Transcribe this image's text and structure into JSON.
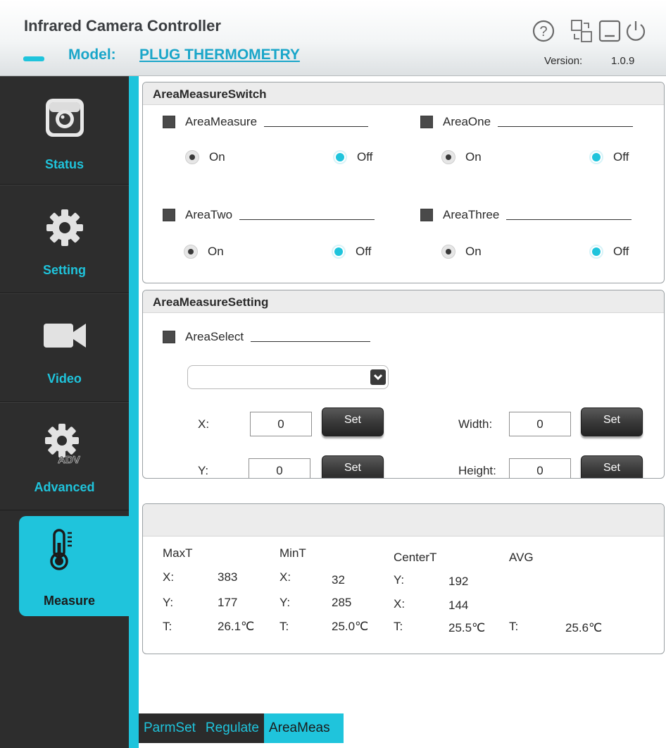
{
  "header": {
    "title": "Infrared Camera Controller",
    "model_label": "Model:",
    "model_value": "PLUG THERMOMETRY",
    "version_label": "Version:",
    "version_value": "1.0.9",
    "icons": [
      "help-icon",
      "switch-icon",
      "minimize-icon",
      "power-icon"
    ]
  },
  "sidebar": {
    "items": [
      {
        "label": "Status",
        "icon": "camera-icon"
      },
      {
        "label": "Setting",
        "icon": "gear-icon"
      },
      {
        "label": "Video",
        "icon": "video-camera-icon"
      },
      {
        "label": "Advanced",
        "icon": "advanced-gear-icon",
        "badge": "ADV"
      },
      {
        "label": "Measure",
        "icon": "thermometer-icon",
        "active": true
      }
    ]
  },
  "area_switch": {
    "title": "AreaMeasureSwitch",
    "groups": [
      {
        "label": "AreaMeasure",
        "on": "On",
        "off": "Off",
        "selected": "Off"
      },
      {
        "label": "AreaOne",
        "on": "On",
        "off": "Off",
        "selected": "Off"
      },
      {
        "label": "AreaTwo",
        "on": "On",
        "off": "Off",
        "selected": "Off"
      },
      {
        "label": "AreaThree",
        "on": "On",
        "off": "Off",
        "selected": "Off"
      }
    ]
  },
  "area_setting": {
    "title": "AreaMeasureSetting",
    "select_label": "AreaSelect",
    "dropdown_value": "",
    "fields": {
      "x_label": "X:",
      "x_value": "0",
      "y_label": "Y:",
      "y_value": "0",
      "width_label": "Width:",
      "width_value": "0",
      "height_label": "Height:",
      "height_value": "0"
    },
    "set_label": "Set"
  },
  "readout": {
    "max": {
      "title": "MaxT",
      "l1": "X:",
      "v1": "383",
      "l2": "Y:",
      "v2": "177",
      "l3": "T:",
      "v3": "26.1℃"
    },
    "min": {
      "title": "MinT",
      "l1": "X:",
      "v1": "32",
      "l2": "Y:",
      "v2": "285",
      "l3": "T:",
      "v3": "25.0℃"
    },
    "center": {
      "title": "CenterT",
      "l1": "Y:",
      "v1": "192",
      "l2": "X:",
      "v2": "144",
      "l3": "T:",
      "v3": "25.5℃"
    },
    "avg": {
      "title": "AVG",
      "l3": "T:",
      "v3": "25.6℃"
    }
  },
  "bottom_tabs": [
    {
      "label": "ParmSet",
      "active": false
    },
    {
      "label": "Regulate",
      "active": false
    },
    {
      "label": "AreaMeas",
      "active": true
    }
  ],
  "colors": {
    "accent": "#1fc4dc",
    "sidebar": "#2d2d2d",
    "button": "#3a3a3a"
  }
}
